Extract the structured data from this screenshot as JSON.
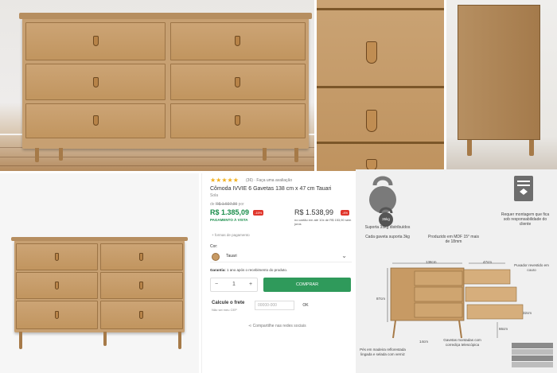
{
  "product": {
    "stars": "★★★★★",
    "rating_count": "(36)",
    "rating_link": "Faça uma avaliação",
    "title": "Cômoda IVVIE 6 Gavetas 138 cm x 47 cm Tauari",
    "brand": "Sola",
    "old_price_prefix": "de",
    "old_price": "R$ 1.607,99",
    "old_price_suffix": "por",
    "price_pix": "R$ 1.385,09",
    "discount_pix": "-15%",
    "pix_label": "PAGAMENTO À VISTA",
    "price_card": "R$ 1.538,99",
    "discount_card": "-4%",
    "installments": "no cartão em até 10x de R$ 153,90 sem juros",
    "payment_link": "+ formas de pagamento",
    "color_label": "Cor:",
    "color_value": "Tauari",
    "color_hex": "#c79a64",
    "warranty_label": "Garantia:",
    "warranty_text": "1 ano após o recebimento do produto.",
    "qty_minus": "−",
    "qty_value": "1",
    "qty_plus": "+",
    "buy_label": "COMPRAR",
    "shipping_title": "Calcule o frete",
    "shipping_link": "Não sei meu CEP",
    "cep_placeholder": "00000-000",
    "ok_label": "OK",
    "share_label": "Compartilhe nas redes sociais",
    "accent_green": "#2f9a5b"
  },
  "infographic": {
    "weight_badge": "35kg",
    "support_text_1": "Suporta 35kg distribuídos",
    "support_text_2": "Cada gaveta suporta 3kg",
    "assembly_text": "Requer montagem que fica sob responsabilidade do cliente",
    "material_text": "Produzido em MDF 15° mais de 18mm",
    "dim_width": "138cm",
    "dim_depth": "47cm",
    "dim_height": "87cm",
    "dim_leg": "14cm",
    "dim_drawer": "32cm",
    "dim_inner": "66cm",
    "handle_text": "Puxador revestido em couro",
    "feet_text": "Pés em madeira reflorestada lingada e selada com verniz",
    "drawer_text": "Gavetas montadas com corrediça telescópica",
    "legend": [
      "",
      "",
      "",
      ""
    ]
  }
}
